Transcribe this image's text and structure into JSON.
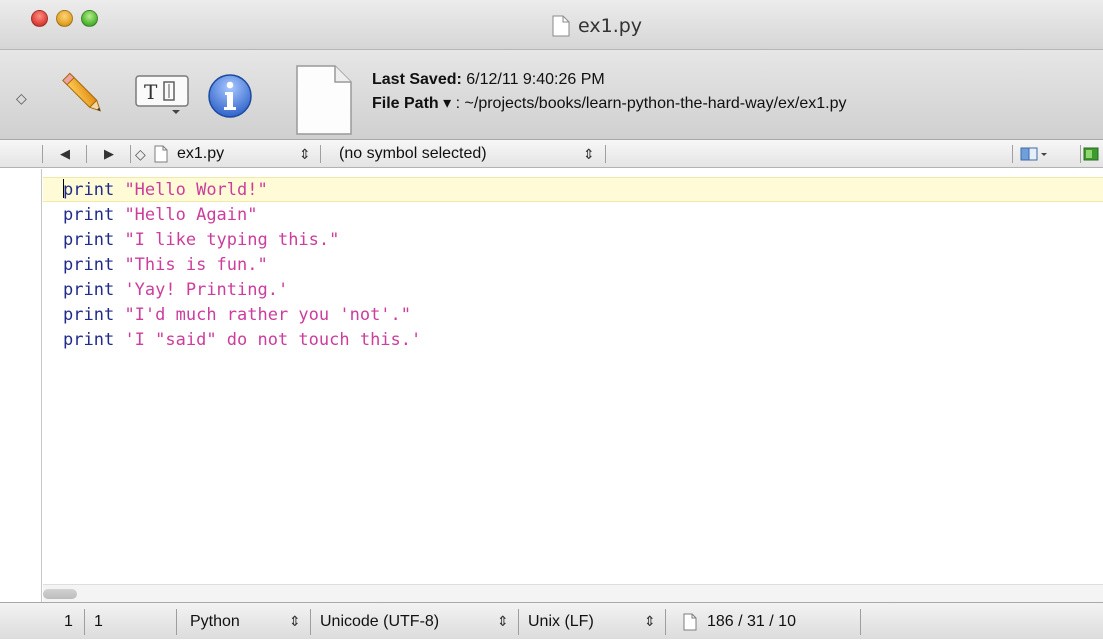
{
  "window": {
    "title": "ex1.py"
  },
  "toolbar": {
    "last_saved_label": "Last Saved:",
    "last_saved_value": "6/12/11 9:40:26 PM",
    "file_path_label": "File Path",
    "file_path_arrow": "▾",
    "file_path_separator": ":",
    "file_path_value": "~/projects/books/learn-python-the-hard-way/ex/ex1.py"
  },
  "navbar": {
    "back": "◀",
    "forward": "▶",
    "marker": "◇",
    "file_name": "ex1.py",
    "stepper": "⇕",
    "symbol": "(no symbol selected)",
    "stepper2": "⇕"
  },
  "editor": {
    "current_line": 1,
    "lines": [
      {
        "keyword": "print",
        "string": "\"Hello World!\""
      },
      {
        "keyword": "print",
        "string": "\"Hello Again\""
      },
      {
        "keyword": "print",
        "string": "\"I like typing this.\""
      },
      {
        "keyword": "print",
        "string": "\"This is fun.\""
      },
      {
        "keyword": "print",
        "string": "'Yay! Printing.'"
      },
      {
        "keyword": "print",
        "string": "\"I'd much rather you 'not'.\""
      },
      {
        "keyword": "print",
        "string": "'I \"said\" do not touch this.'"
      }
    ]
  },
  "status": {
    "line": "1",
    "column": "1",
    "language": "Python",
    "encoding": "Unicode (UTF-8)",
    "line_endings": "Unix (LF)",
    "stats": "186 / 31 / 10",
    "stepper": "⇕"
  },
  "colors": {
    "keyword": "#1f2a8a",
    "string": "#cc3d9c",
    "current_line_highlight": "#fffbd6"
  },
  "icons": {
    "pencil": "pencil-icon",
    "text_options": "text-options-icon",
    "info": "info-icon",
    "document": "document-icon",
    "bookmark": "bookmark-icon",
    "split": "split-view-icon"
  }
}
